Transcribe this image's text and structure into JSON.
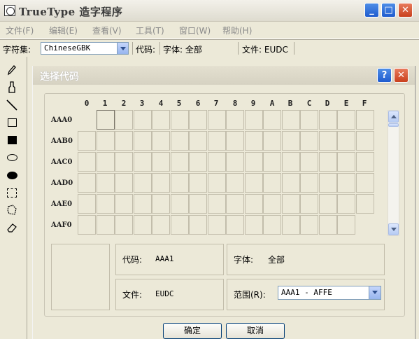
{
  "window": {
    "title": "TrueType 造字程序",
    "buttons": {
      "minimize": "_",
      "maximize": "□",
      "close": "✕"
    }
  },
  "menu": [
    {
      "label": "文件(F)"
    },
    {
      "label": "编辑(E)"
    },
    {
      "label": "查看(V)"
    },
    {
      "label": "工具(T)"
    },
    {
      "label": "窗口(W)"
    },
    {
      "label": "帮助(H)"
    }
  ],
  "toolbar": {
    "charset_label": "字符集:",
    "charset_value": "ChineseGBK",
    "code_label": "代码:",
    "font_label": "字体: 全部",
    "file_label": "文件: EUDC"
  },
  "palette": [
    "pencil-icon",
    "brush-icon",
    "line-icon",
    "rectangle-outline-icon",
    "rectangle-filled-icon",
    "ellipse-outline-icon",
    "ellipse-filled-icon",
    "rect-select-icon",
    "freeform-select-icon",
    "eraser-icon"
  ],
  "dialog": {
    "title": "选择代码",
    "help": "?",
    "close": "✕",
    "columns": [
      "0",
      "1",
      "2",
      "3",
      "4",
      "5",
      "6",
      "7",
      "8",
      "9",
      "A",
      "B",
      "C",
      "D",
      "E",
      "F"
    ],
    "rows": [
      "AAA0",
      "AAB0",
      "AAC0",
      "AAD0",
      "AAE0",
      "AAF0"
    ],
    "code_key": "代码:",
    "code_value": "AAA1",
    "font_key": "字体:",
    "font_value": "全部",
    "file_key": "文件:",
    "file_value": "EUDC",
    "range_key": "范围(R):",
    "range_value": "AAA1 - AFFE",
    "ok": "确定",
    "cancel": "取消"
  },
  "colors": {
    "title_blue": "#1f5ccf",
    "close_red": "#c9401d",
    "face": "#ece9d8"
  }
}
